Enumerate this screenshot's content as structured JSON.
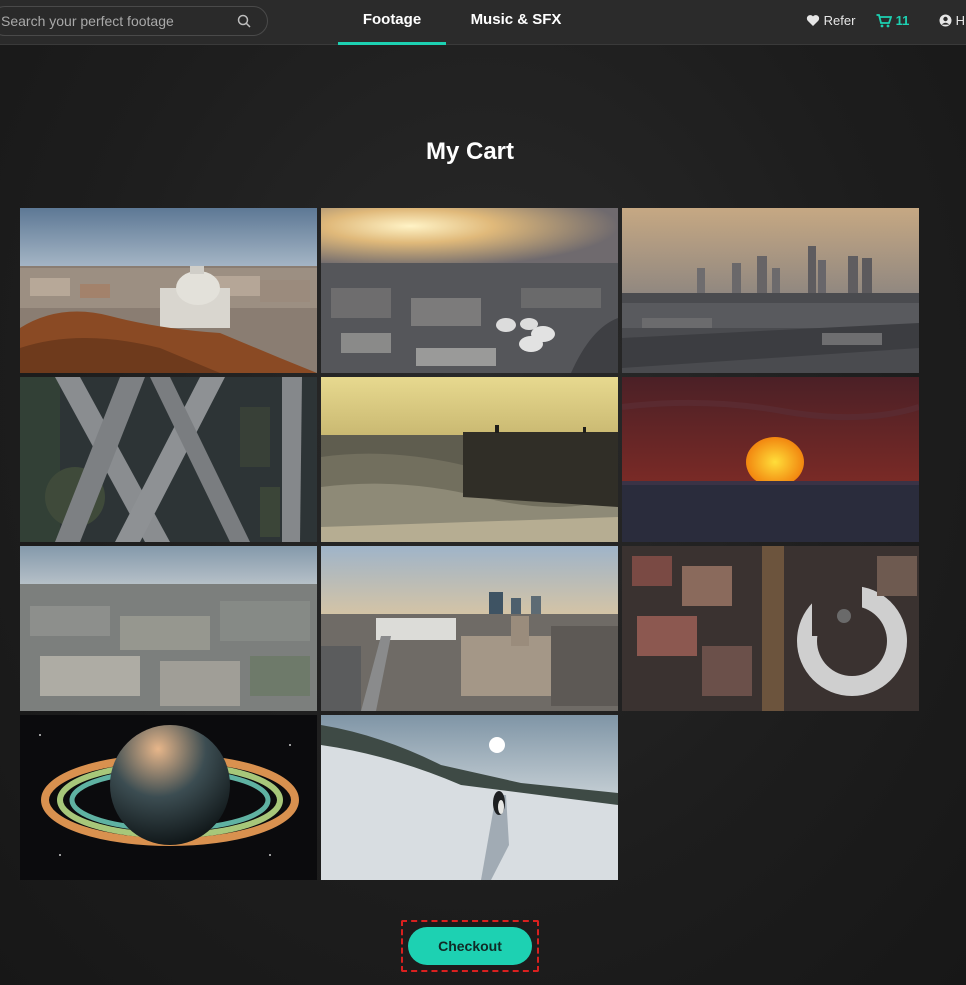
{
  "header": {
    "search": {
      "placeholder": "Search your perfect footage",
      "icon": "search-icon"
    },
    "tabs": [
      {
        "label": "Footage",
        "active": true
      },
      {
        "label": "Music & SFX",
        "active": false
      }
    ],
    "refer_label": "Refer",
    "cart_count": "11",
    "account_initial": "H"
  },
  "page": {
    "title": "My Cart"
  },
  "cart_items": [
    {
      "name": "rome-aerial-dome"
    },
    {
      "name": "industrial-sunset-aerial"
    },
    {
      "name": "city-skyline-dusk"
    },
    {
      "name": "highway-interchange-aerial"
    },
    {
      "name": "waves-pier-golden"
    },
    {
      "name": "sun-setting-over-sea"
    },
    {
      "name": "european-city-aerial"
    },
    {
      "name": "downtown-campus-aerial"
    },
    {
      "name": "city-night-topdown"
    },
    {
      "name": "ringed-planet"
    },
    {
      "name": "penguin-snowfield"
    }
  ],
  "checkout": {
    "label": "Checkout"
  },
  "colors": {
    "accent": "#1dd1b2",
    "background": "#1d1d1d",
    "highlight_border": "#d9201f"
  }
}
